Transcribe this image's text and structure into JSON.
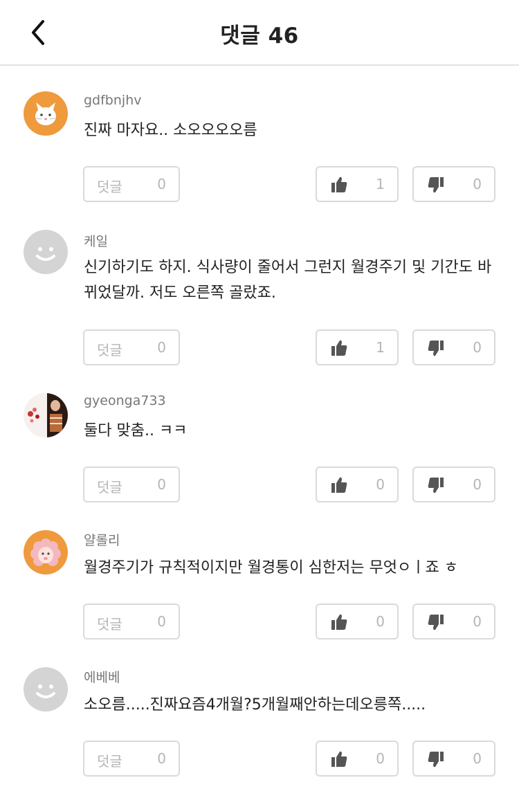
{
  "header": {
    "title": "댓글 46"
  },
  "comments": [
    {
      "author": "gdfbnjhv",
      "text": "진짜 마자요.. 소오오오오름",
      "avatar": "cat-avatar",
      "reply_label": "덧글",
      "reply_count": "0",
      "like_count": "1",
      "dislike_count": "0"
    },
    {
      "author": "케일",
      "text": "신기하기도 하지. 식사량이 줄어서 그런지 월경주기 및 기간도 바뀌었달까. 저도 오른쪽 골랐죠.",
      "avatar": "default-smiley-avatar",
      "reply_label": "덧글",
      "reply_count": "0",
      "like_count": "1",
      "dislike_count": "0"
    },
    {
      "author": "gyeonga733",
      "text": "둘다 맞춤.. ㅋㅋ",
      "avatar": "photo-avatar",
      "reply_label": "덧글",
      "reply_count": "0",
      "like_count": "0",
      "dislike_count": "0"
    },
    {
      "author": "얄롤리",
      "text": "월경주기가 규칙적이지만 월경통이 심한저는 무엇ㅇㅣ죠 ㅎ",
      "avatar": "sheep-avatar",
      "reply_label": "덧글",
      "reply_count": "0",
      "like_count": "0",
      "dislike_count": "0"
    },
    {
      "author": "에베베",
      "text": "소오름.....진짜요즘4개월?5개월째안하는데오릉쪽.....",
      "avatar": "default-smiley-avatar",
      "reply_label": "덧글",
      "reply_count": "0",
      "like_count": "0",
      "dislike_count": "0"
    }
  ],
  "colors": {
    "avatar_orange": "#ee9a3d",
    "avatar_gray": "#d4d4d4",
    "button_border": "#dadada",
    "muted_text": "#b5b5b5",
    "icon_dark": "#555555"
  }
}
